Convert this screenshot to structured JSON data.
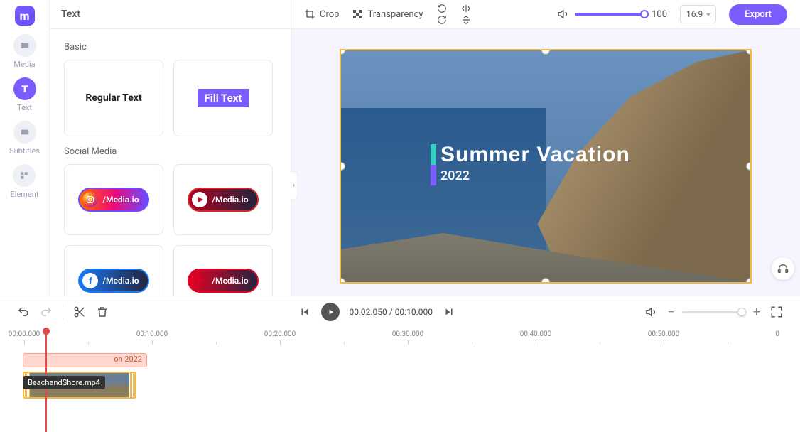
{
  "rail": {
    "media": "Media",
    "text": "Text",
    "subtitles": "Subtitles",
    "element": "Element"
  },
  "panel": {
    "header": "Text",
    "section_basic": "Basic",
    "section_social": "Social Media",
    "card_regular": "Regular Text",
    "card_fill": "Fill Text",
    "social_handle": "/Media.io"
  },
  "toolbar": {
    "crop": "Crop",
    "transparency": "Transparency",
    "volume_value": "100",
    "aspect_ratio": "16:9",
    "export": "Export"
  },
  "overlay": {
    "title": "Summer Vacation",
    "subtitle": "2022"
  },
  "playback": {
    "current": "00:02.050",
    "sep": " / ",
    "total": "00:10.000"
  },
  "ruler": {
    "t0": "00:00.000",
    "t1": "00:10.000",
    "t2": "00:20.000",
    "t3": "00:30.000",
    "t4": "00:40.000",
    "t5": "00:50.000",
    "t6": "0"
  },
  "timeline": {
    "text_clip_label": "on 2022",
    "tooltip_filename": "BeachandShore.mp4"
  }
}
